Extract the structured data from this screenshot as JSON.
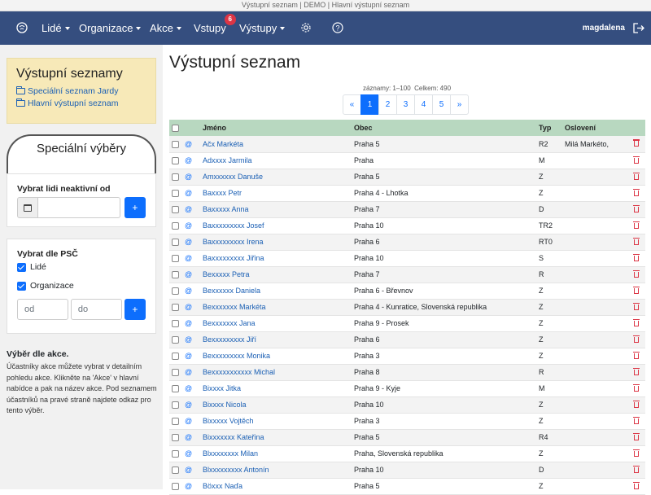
{
  "window_title": "Výstupní seznam | DEMO | Hlavní výstupní seznam",
  "nav": {
    "logo_icon": "brain-icon",
    "items": [
      {
        "label": "Lidé",
        "dropdown": true
      },
      {
        "label": "Organizace",
        "dropdown": true
      },
      {
        "label": "Akce",
        "dropdown": true
      },
      {
        "label": "Vstupy",
        "dropdown": false,
        "badge": "6"
      },
      {
        "label": "Výstupy",
        "dropdown": true
      }
    ],
    "settings_icon": "gear-icon",
    "help_icon": "question-circle-icon",
    "user": "magdalena",
    "logout_icon": "logout-icon"
  },
  "sidebar": {
    "lists_title": "Výstupní seznamy",
    "lists": [
      "Speciální seznam Jardy",
      "Hlavní výstupní seznam"
    ],
    "special_title": "Speciální výběry",
    "inactive": {
      "label": "Vybrat lidi neaktivní od",
      "date_value": "",
      "button": "+"
    },
    "psc": {
      "label": "Vybrat dle PSČ",
      "check_people": "Lidé",
      "check_orgs": "Organizace",
      "from_placeholder": "od",
      "to_placeholder": "do",
      "button": "+"
    },
    "help_title": "Výběr dle akce.",
    "help_text": "Účastníky akce můžete vybrat v detailním pohledu akce. Klikněte na 'Akce' v hlavní nabídce a pak na název akce. Pod seznamem účastníků na pravé straně najdete odkaz pro tento výběr."
  },
  "main": {
    "title": "Výstupní seznam",
    "records_label": "záznamy: 1–100",
    "total_label": "Celkem: 490",
    "pagination": [
      "«",
      "1",
      "2",
      "3",
      "4",
      "5",
      "»"
    ],
    "active_page": "1",
    "columns": [
      "",
      "",
      "Jméno",
      "Obec",
      "Typ",
      "Oslovení",
      ""
    ]
  },
  "rows": [
    {
      "name": "Ačx Markéta",
      "city": "Praha 5",
      "type": "R2",
      "greeting": "Milá Markéto,"
    },
    {
      "name": "Adxxxx Jarmila",
      "city": "Praha",
      "type": "M",
      "greeting": ""
    },
    {
      "name": "Amxxxxxx Danuše",
      "city": "Praha 5",
      "type": "Z",
      "greeting": ""
    },
    {
      "name": "Baxxxx Petr",
      "city": "Praha 4 - Lhotka",
      "type": "Z",
      "greeting": ""
    },
    {
      "name": "Baxxxxx Anna",
      "city": "Praha 7",
      "type": "D",
      "greeting": ""
    },
    {
      "name": "Baxxxxxxxxx Josef",
      "city": "Praha 10",
      "type": "TR2",
      "greeting": ""
    },
    {
      "name": "Baxxxxxxxxx Irena",
      "city": "Praha 6",
      "type": "RT0",
      "greeting": ""
    },
    {
      "name": "Baxxxxxxxxx Jiřina",
      "city": "Praha 10",
      "type": "S",
      "greeting": ""
    },
    {
      "name": "Bexxxxx Petra",
      "city": "Praha 7",
      "type": "R",
      "greeting": ""
    },
    {
      "name": "Bexxxxxx Daniela",
      "city": "Praha 6 - Břevnov",
      "type": "Z",
      "greeting": ""
    },
    {
      "name": "Bexxxxxxx Markéta",
      "city": "Praha 4 - Kunratice, Slovenská republika",
      "type": "Z",
      "greeting": ""
    },
    {
      "name": "Bexxxxxxx Jana",
      "city": "Praha 9 - Prosek",
      "type": "Z",
      "greeting": ""
    },
    {
      "name": "Bexxxxxxxxx Jiří",
      "city": "Praha 6",
      "type": "Z",
      "greeting": ""
    },
    {
      "name": "Bexxxxxxxxx Monika",
      "city": "Praha 3",
      "type": "Z",
      "greeting": ""
    },
    {
      "name": "Bexxxxxxxxxxx Michal",
      "city": "Praha 8",
      "type": "R",
      "greeting": ""
    },
    {
      "name": "Bixxxx Jitka",
      "city": "Praha 9 - Kyje",
      "type": "M",
      "greeting": ""
    },
    {
      "name": "Bixxxx Nicola",
      "city": "Praha 10",
      "type": "Z",
      "greeting": ""
    },
    {
      "name": "Bixxxxx Vojtěch",
      "city": "Praha 3",
      "type": "Z",
      "greeting": ""
    },
    {
      "name": "Bixxxxxxx Kateřina",
      "city": "Praha 5",
      "type": "R4",
      "greeting": ""
    },
    {
      "name": "Blxxxxxxxx Milan",
      "city": "Praha, Slovenská republika",
      "type": "Z",
      "greeting": ""
    },
    {
      "name": "Blxxxxxxxxx Antonín",
      "city": "Praha 10",
      "type": "D",
      "greeting": ""
    },
    {
      "name": "Böxxx Naďa",
      "city": "Praha 5",
      "type": "Z",
      "greeting": ""
    }
  ],
  "colors": {
    "navbar": "#354e7f",
    "accent": "#0d6efd",
    "header_row": "#b8d8c0",
    "danger": "#dc3545",
    "panel": "#f7e9b8"
  }
}
